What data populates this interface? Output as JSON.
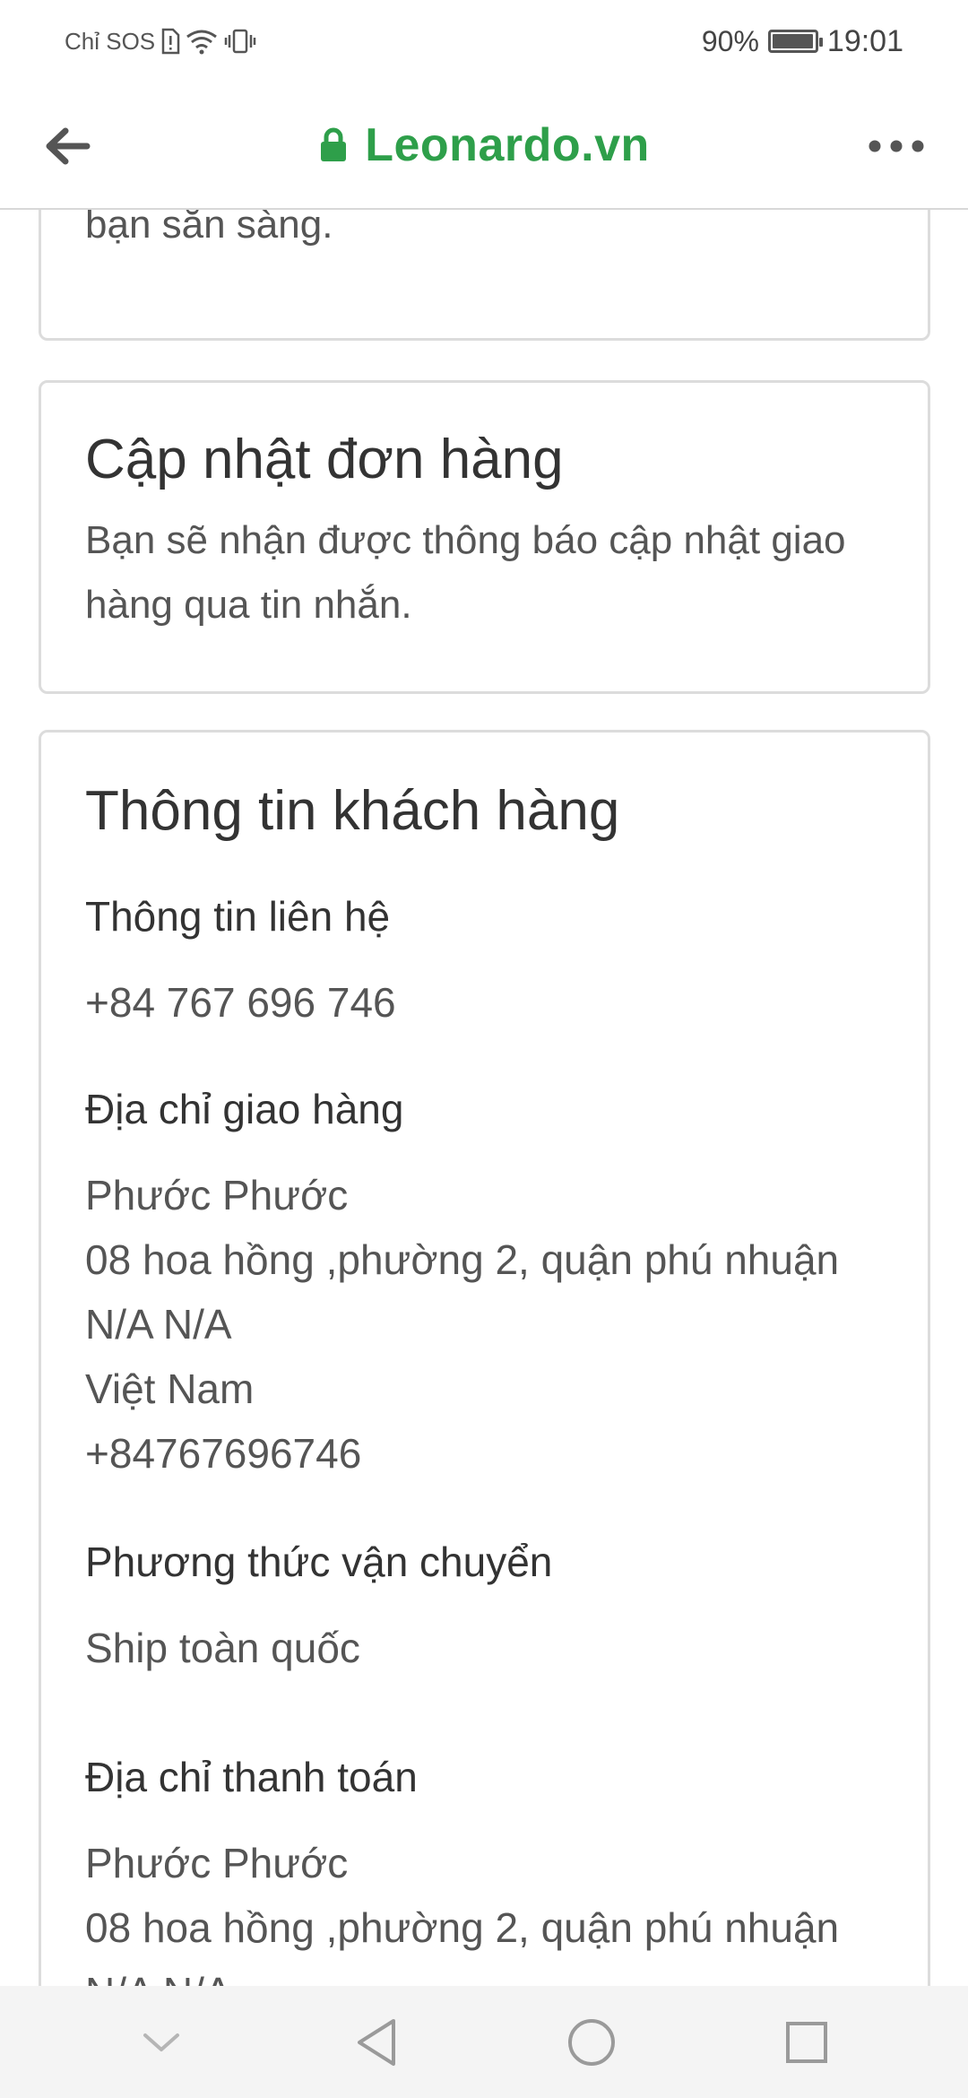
{
  "status_bar": {
    "carrier": "Chỉ SOS",
    "battery_percent": "90%",
    "battery_level": 0.9,
    "time": "19:01"
  },
  "browser": {
    "url_text": "Leonardo.vn",
    "back_icon": "arrow-left-icon",
    "lock_icon": "lock-icon",
    "more_icon": "more-horizontal-icon",
    "accent_color": "#2e9f4a"
  },
  "cards": {
    "ready": {
      "text": "Bạn sẽ nhận được tin nhắn khi đơn hàng của bạn sẵn sàng."
    },
    "order_update": {
      "title": "Cập nhật đơn hàng",
      "text": "Bạn sẽ nhận được thông báo cập nhật giao hàng qua tin nhắn."
    },
    "customer_info": {
      "title": "Thông tin khách hàng",
      "contact_label": "Thông tin liên hệ",
      "contact_phone": "+84 767 696 746",
      "shipping_label": "Địa chỉ giao hàng",
      "shipping_lines": [
        "Phước Phước",
        "08 hoa hồng ,phường 2, quận phú nhuận",
        "N/A N/A",
        "Việt Nam",
        "+84767696746"
      ],
      "shipping_method_label": "Phương thức vận chuyển",
      "shipping_method": "Ship toàn quốc",
      "billing_label": "Địa chỉ thanh toán",
      "billing_lines": [
        "Phước Phước",
        "08 hoa hồng ,phường 2, quận phú nhuận",
        "N/A N/A"
      ]
    }
  },
  "nav_bar": {
    "icons": [
      "chevron-down-icon",
      "back-triangle-icon",
      "home-circle-icon",
      "recents-square-icon"
    ]
  }
}
